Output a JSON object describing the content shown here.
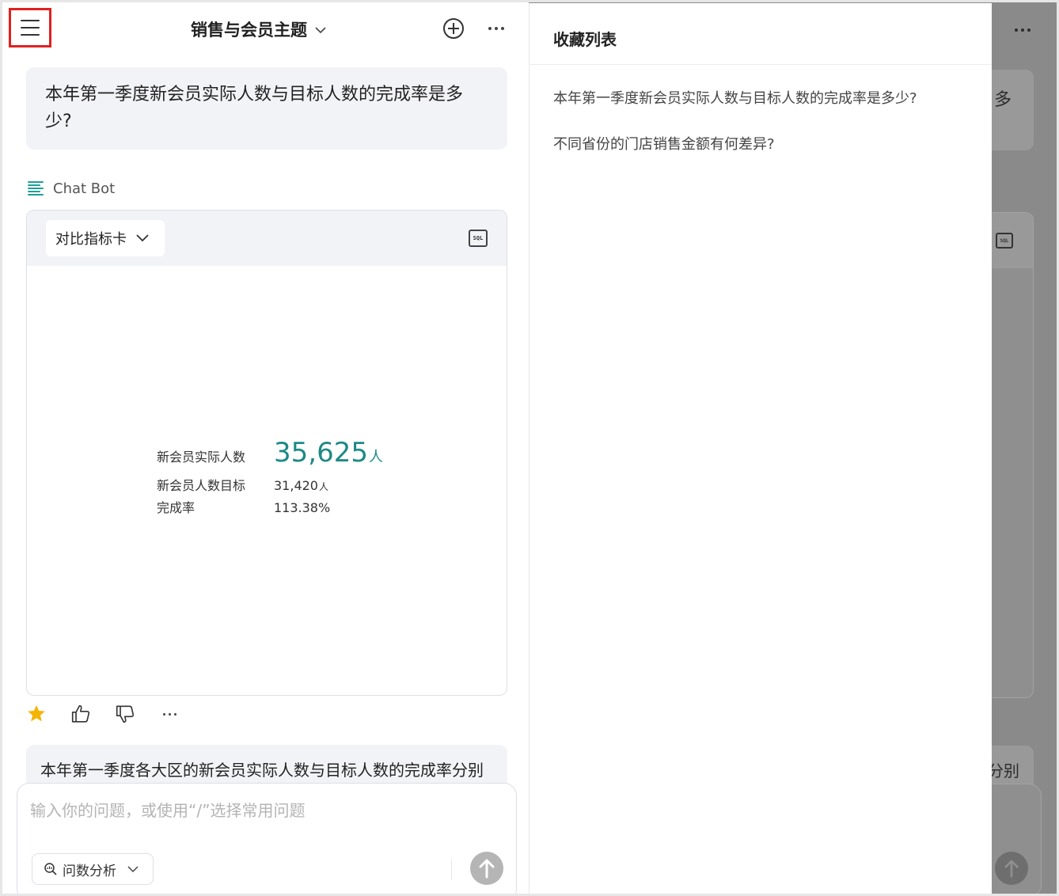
{
  "header": {
    "menu_icon": "hamburger-menu-icon",
    "topic_title": "销售与会员主题",
    "new_chat_icon": "plus-circle-icon",
    "more_icon": "more-horizontal-icon"
  },
  "conversation": {
    "question": "本年第一季度新会员实际人数与目标人数的完成率是多少?",
    "bot_name": "Chat Bot",
    "bot_icon": "bot-lines-icon",
    "card": {
      "chart_type_label": "对比指标卡",
      "sql_icon_text": "SQL",
      "metrics": {
        "actual_label": "新会员实际人数",
        "actual_value": "35,625",
        "actual_unit": "人",
        "target_label": "新会员人数目标",
        "target_value": "31,420",
        "target_unit": "人",
        "rate_label": "完成率",
        "rate_value": "113.38%"
      }
    },
    "actions": {
      "favorite_icon": "star-icon",
      "like_icon": "thumbs-up-icon",
      "dislike_icon": "thumbs-down-icon",
      "more_icon": "more-horizontal-icon",
      "favorite_color": "#f5b400"
    },
    "next_question": "本年第一季度各大区的新会员实际人数与目标人数的完成率分别"
  },
  "composer": {
    "placeholder": "输入你的问题，或使用“/”选择常用问题",
    "mode_label": "问数分析",
    "send_icon": "arrow-up-icon"
  },
  "favorites": {
    "title": "收藏列表",
    "items": [
      "本年第一季度新会员实际人数与目标人数的完成率是多少?",
      "不同省份的门店销售金额有何差异?"
    ]
  },
  "background": {
    "question_tail": "多",
    "next_question_tail": "分别"
  },
  "colors": {
    "accent_teal": "#1e8a86",
    "highlight_red": "#e02020"
  }
}
